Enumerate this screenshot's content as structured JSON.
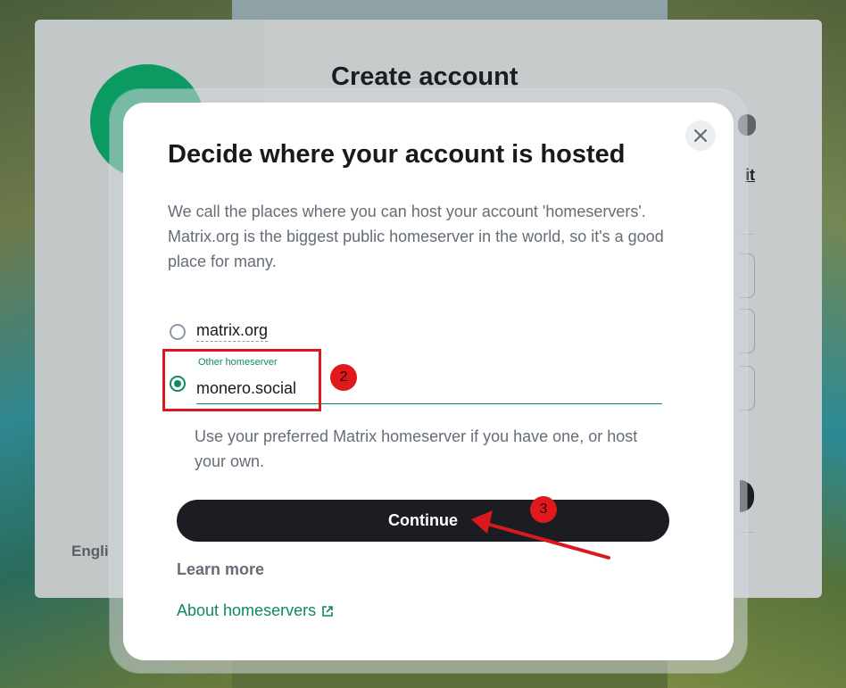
{
  "background": {
    "page_title": "Create account",
    "language": "Engli",
    "link_fragment": "it"
  },
  "dialog": {
    "title": "Decide where your account is hosted",
    "description": "We call the places where you can host your account 'homeservers'. Matrix.org is the biggest public homeserver in the world, so it's a good place for many.",
    "options": {
      "matrix_org": "matrix.org",
      "other_label": "Other homeserver",
      "other_value": "monero.social"
    },
    "helper": "Use your preferred Matrix homeserver if you have one, or host your own.",
    "continue_label": "Continue",
    "learn_more": "Learn more",
    "about_link": "About homeservers"
  },
  "annotations": {
    "step2": "2",
    "step3": "3"
  },
  "colors": {
    "accent": "#0e8a5f",
    "button": "#1b1d22",
    "annotation": "#d9191d"
  },
  "icons": {
    "close": "close-icon",
    "external": "external-link-icon"
  }
}
